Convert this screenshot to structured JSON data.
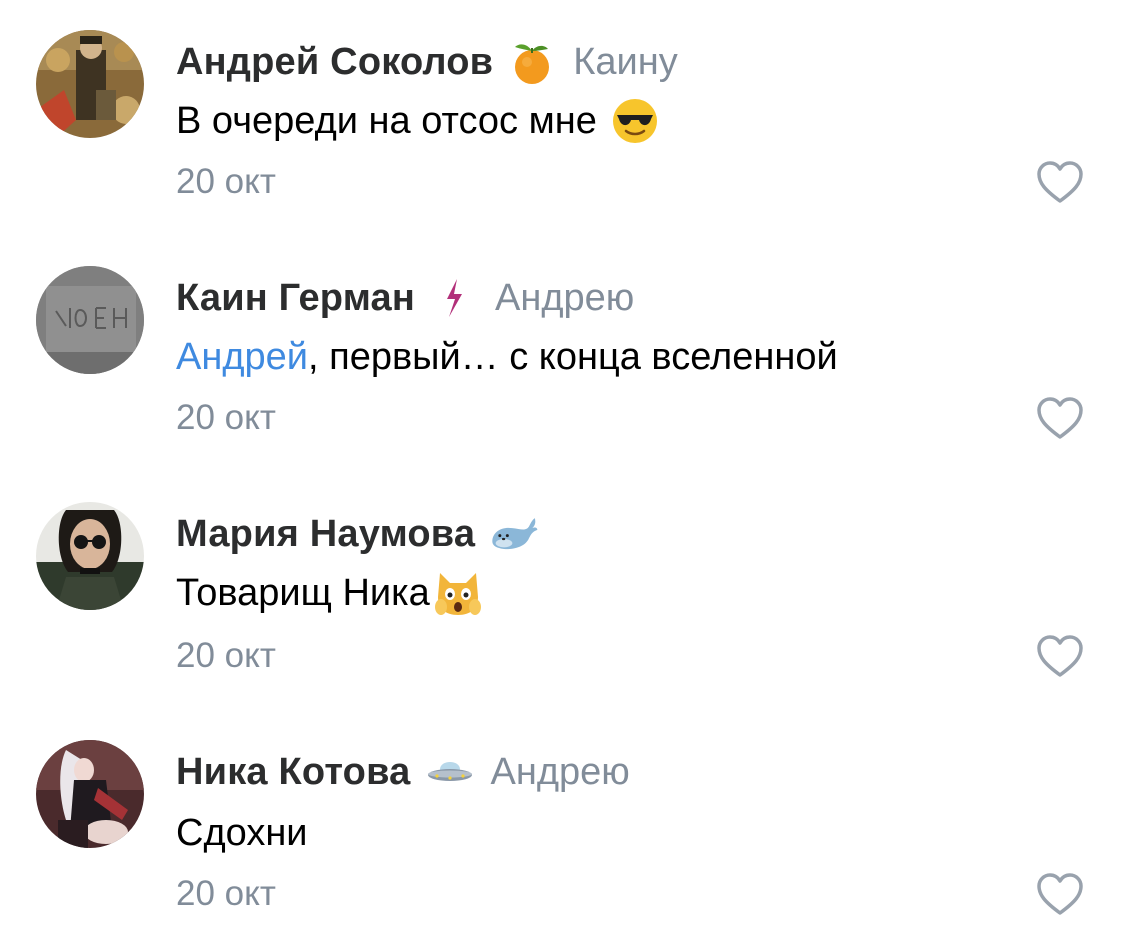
{
  "comments": [
    {
      "author": "Андрей Соколов",
      "badge_icon": "tangerine-icon",
      "reply_to": "Каину",
      "mention": "",
      "text": "В очереди на отсос мне",
      "text_emoji": "sunglasses-face-icon",
      "date": "20 окт",
      "avatar": "avatar-andrey-sokolov"
    },
    {
      "author": "Каин Герман",
      "badge_icon": "lightning-icon",
      "reply_to": "Андрею",
      "mention": "Андрей",
      "text": ", первый… с конца вселенной",
      "text_emoji": "",
      "date": "20 окт",
      "avatar": "avatar-kain-german"
    },
    {
      "author": "Мария Наумова",
      "badge_icon": "seal-icon",
      "reply_to": "",
      "mention": "",
      "text": "Товарищ Ника",
      "text_emoji": "weary-cat-icon",
      "date": "20 окт",
      "avatar": "avatar-maria-naumova"
    },
    {
      "author": "Ника Котова",
      "badge_icon": "ufo-icon",
      "reply_to": "Андрею",
      "mention": "",
      "text": "Сдохни",
      "text_emoji": "",
      "date": "20 окт",
      "avatar": "avatar-nika-kotova"
    }
  ],
  "colors": {
    "author": "#2c2d2e",
    "secondary": "#818c99",
    "mention": "#3f8ae0",
    "text": "#000000"
  }
}
